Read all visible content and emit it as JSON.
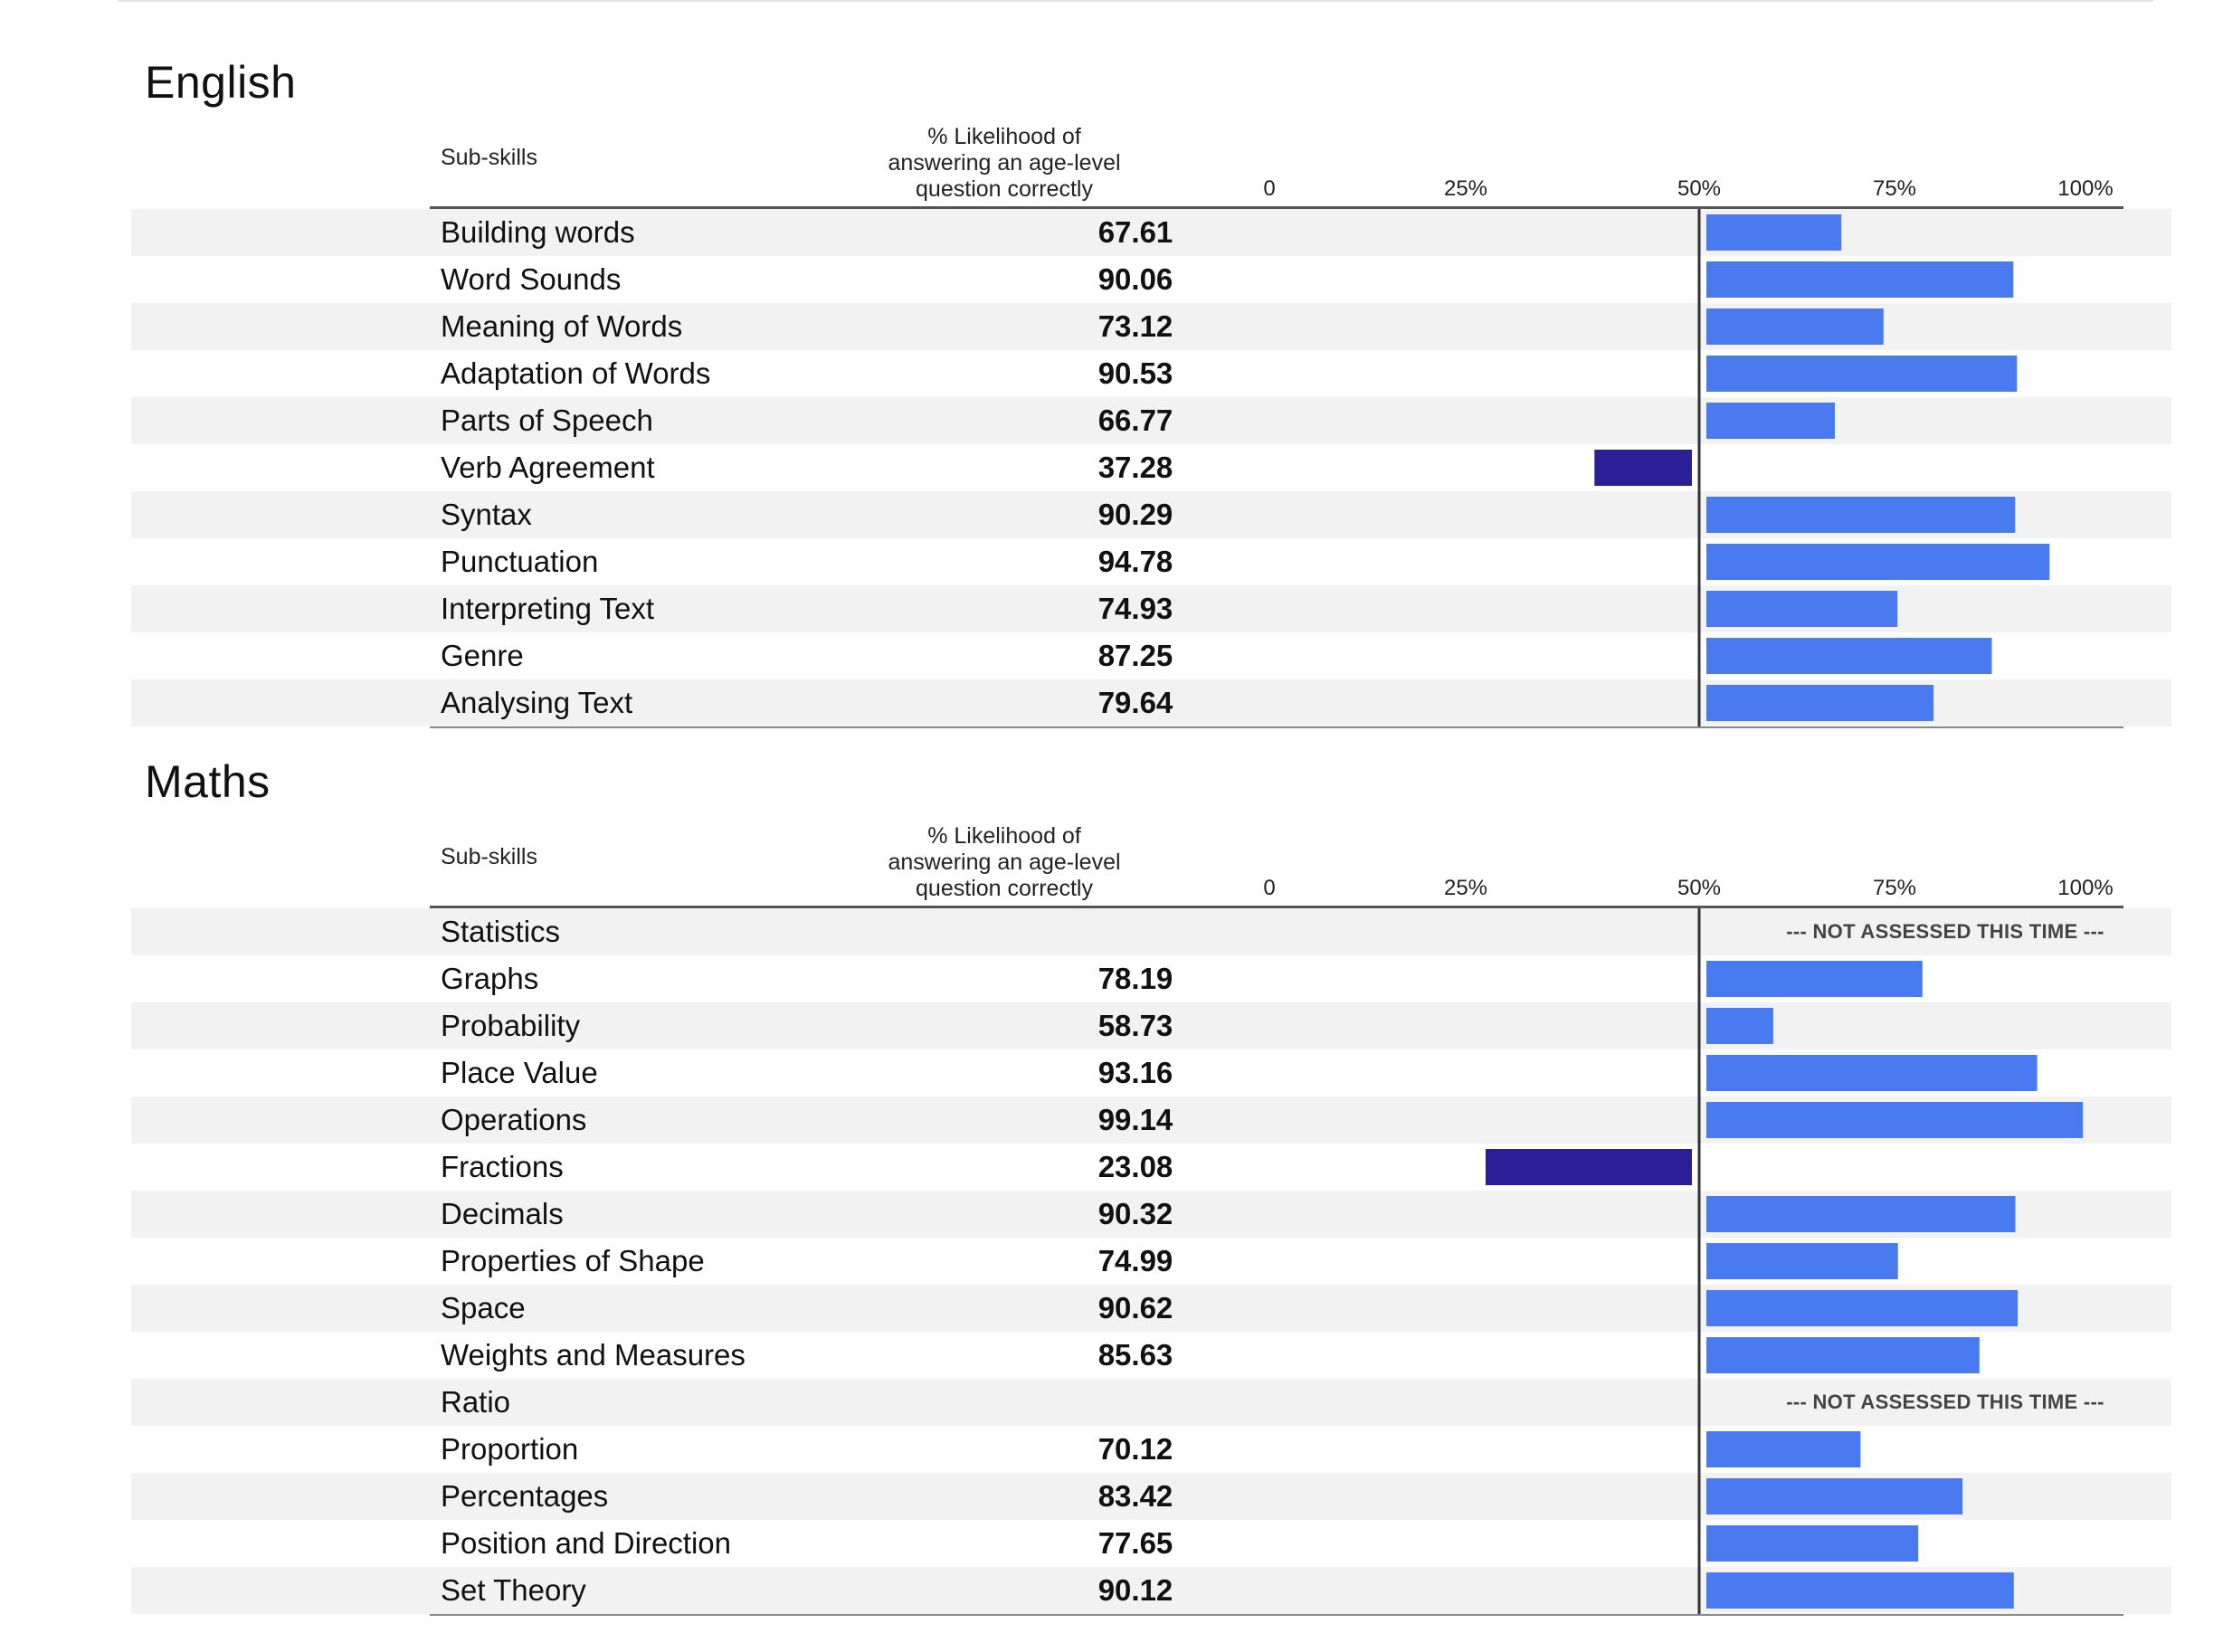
{
  "sections": [
    {
      "title": "English",
      "header_subskills": "Sub-skills",
      "header_likelihood": [
        "% Likelihood of",
        "answering an age-level",
        "question correctly"
      ],
      "ticks": [
        "0",
        "25%",
        "50%",
        "75%",
        "100%"
      ],
      "rows": [
        {
          "label": "Building words",
          "value": "67.61"
        },
        {
          "label": "Word Sounds",
          "value": "90.06"
        },
        {
          "label": "Meaning of Words",
          "value": "73.12"
        },
        {
          "label": "Adaptation of Words",
          "value": "90.53"
        },
        {
          "label": "Parts of Speech",
          "value": "66.77"
        },
        {
          "label": "Verb Agreement",
          "value": "37.28"
        },
        {
          "label": "Syntax",
          "value": "90.29"
        },
        {
          "label": "Punctuation",
          "value": "94.78"
        },
        {
          "label": "Interpreting Text",
          "value": "74.93"
        },
        {
          "label": "Genre",
          "value": "87.25"
        },
        {
          "label": "Analysing Text",
          "value": "79.64"
        }
      ]
    },
    {
      "title": "Maths",
      "header_subskills": "Sub-skills",
      "header_likelihood": [
        "% Likelihood of",
        "answering an age-level",
        "question correctly"
      ],
      "ticks": [
        "0",
        "25%",
        "50%",
        "75%",
        "100%"
      ],
      "rows": [
        {
          "label": "Statistics",
          "value": "",
          "note": "--- NOT ASSESSED THIS TIME ---"
        },
        {
          "label": "Graphs",
          "value": "78.19"
        },
        {
          "label": "Probability",
          "value": "58.73"
        },
        {
          "label": "Place Value",
          "value": "93.16"
        },
        {
          "label": "Operations",
          "value": "99.14"
        },
        {
          "label": "Fractions",
          "value": "23.08"
        },
        {
          "label": "Decimals",
          "value": "90.32"
        },
        {
          "label": "Properties of Shape",
          "value": "74.99"
        },
        {
          "label": "Space",
          "value": "90.62"
        },
        {
          "label": "Weights and Measures",
          "value": "85.63"
        },
        {
          "label": "Ratio",
          "value": "",
          "note": "--- NOT ASSESSED THIS TIME ---"
        },
        {
          "label": "Proportion",
          "value": "70.12"
        },
        {
          "label": "Percentages",
          "value": "83.42"
        },
        {
          "label": "Position and Direction",
          "value": "77.65"
        },
        {
          "label": "Set Theory",
          "value": "90.12"
        }
      ]
    }
  ],
  "chart_data": [
    {
      "type": "bar",
      "title": "English",
      "categories": [
        "Building words",
        "Word Sounds",
        "Meaning of Words",
        "Adaptation of Words",
        "Parts of Speech",
        "Verb Agreement",
        "Syntax",
        "Punctuation",
        "Interpreting Text",
        "Genre",
        "Analysing Text"
      ],
      "values": [
        67.61,
        90.06,
        73.12,
        90.53,
        66.77,
        37.28,
        90.29,
        94.78,
        74.93,
        87.25,
        79.64
      ],
      "xlim": [
        0,
        100
      ],
      "reference_line": 50,
      "orientation": "horizontal-diverging",
      "colors": {
        "above": "#4a7aef",
        "below": "#2a1f96"
      }
    },
    {
      "type": "bar",
      "title": "Maths",
      "categories": [
        "Statistics",
        "Graphs",
        "Probability",
        "Place Value",
        "Operations",
        "Fractions",
        "Decimals",
        "Properties of Shape",
        "Space",
        "Weights and Measures",
        "Ratio",
        "Proportion",
        "Percentages",
        "Position and Direction",
        "Set Theory"
      ],
      "values": [
        null,
        78.19,
        58.73,
        93.16,
        99.14,
        23.08,
        90.32,
        74.99,
        90.62,
        85.63,
        null,
        70.12,
        83.42,
        77.65,
        90.12
      ],
      "xlim": [
        0,
        100
      ],
      "reference_line": 50,
      "orientation": "horizontal-diverging",
      "colors": {
        "above": "#4a7aef",
        "below": "#2a1f96"
      }
    }
  ]
}
